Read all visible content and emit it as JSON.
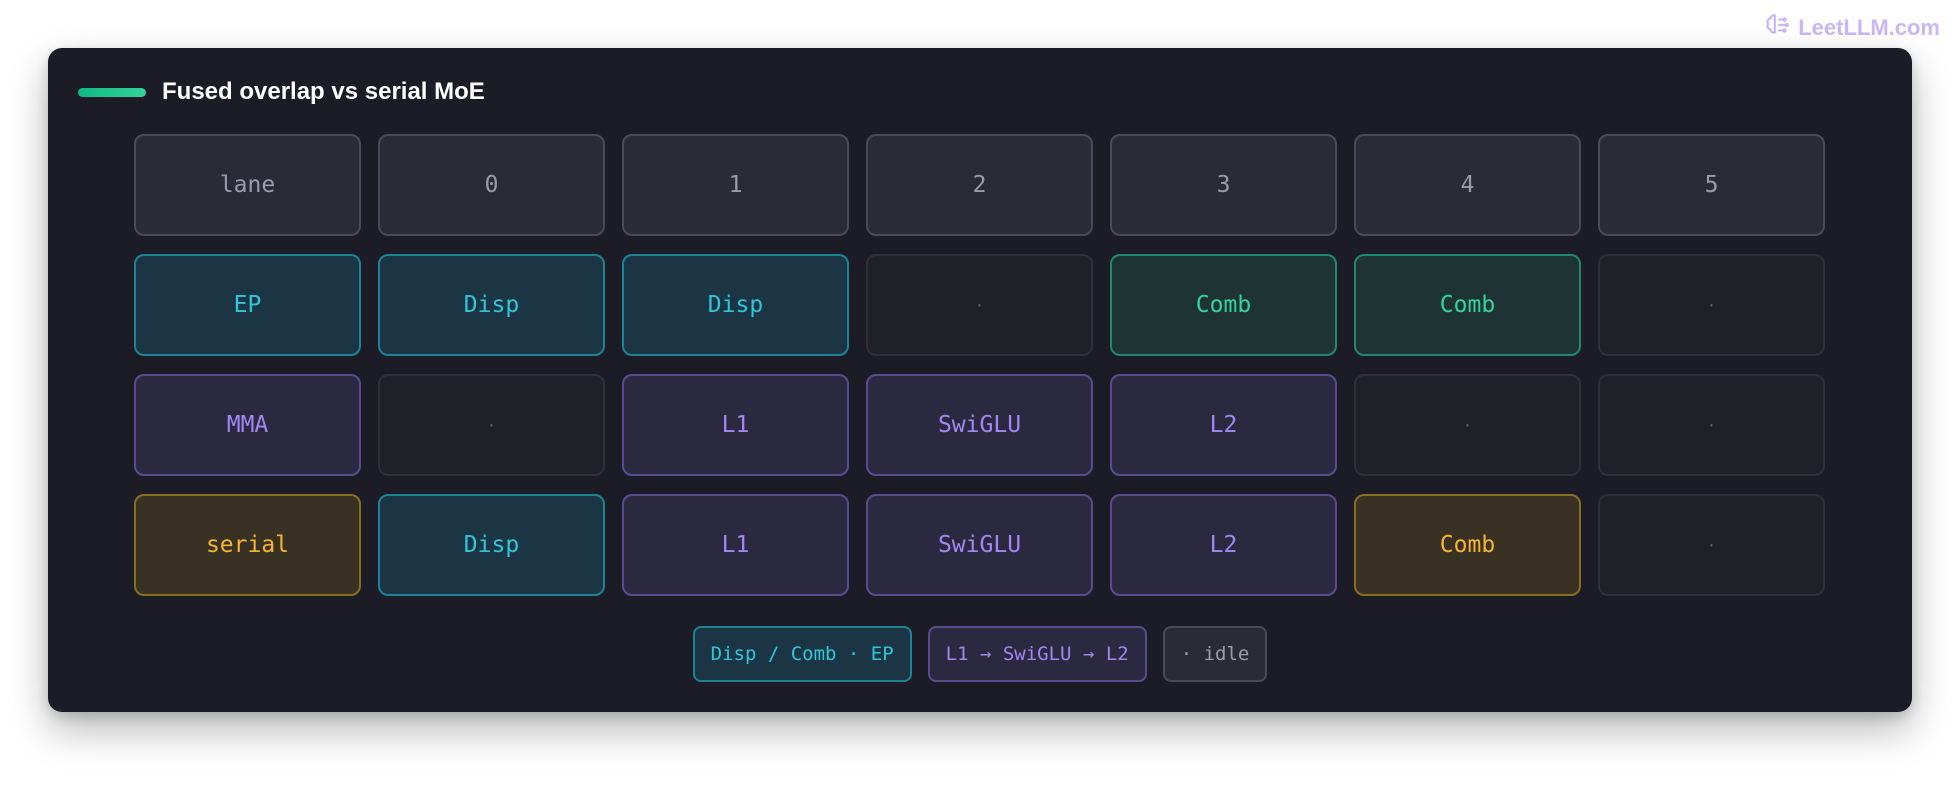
{
  "brand": {
    "text": "LeetLLM.com",
    "icon": "brain-icon"
  },
  "title": "Fused overlap vs serial MoE",
  "colors": {
    "ep": "#2fc6da",
    "mma": "#a286f2",
    "comb": "#34d399",
    "serial": "#f5b52e",
    "accent_bar": "#10b981"
  },
  "header": [
    "lane",
    "0",
    "1",
    "2",
    "3",
    "4",
    "5"
  ],
  "rows": [
    {
      "lane": "EP",
      "cells": [
        "Disp",
        "Disp",
        "·",
        "Comb",
        "Comb",
        "·"
      ]
    },
    {
      "lane": "MMA",
      "cells": [
        "·",
        "L1",
        "SwiGLU",
        "L2",
        "·",
        "·"
      ]
    },
    {
      "lane": "serial",
      "cells": [
        "Disp",
        "L1",
        "SwiGLU",
        "L2",
        "Comb",
        "·"
      ]
    }
  ],
  "legend": [
    "Disp / Comb · EP",
    "L1 → SwiGLU → L2",
    "· idle"
  ]
}
